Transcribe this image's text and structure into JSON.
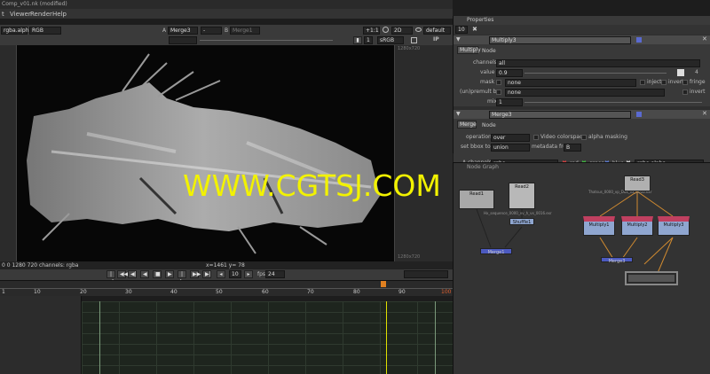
{
  "window": {
    "title": "Comp_v01.nk  (modified)"
  },
  "menubar": {
    "items": [
      "t",
      "Viewer",
      "Render",
      "Help"
    ]
  },
  "viewer": {
    "channel": "rgba.alpha",
    "colorspace": "RGB",
    "a_label": "A",
    "input_a": "Merge3",
    "a_op": "-",
    "b_label": "B",
    "input_b": "Merge1",
    "zoom": "+1:1",
    "view_mode": "2D",
    "lut": "default",
    "frame": "1",
    "display_lut": "sRGB",
    "format_top": "1280x720",
    "format_bottom": "1280x720",
    "info_left": "0 0 1280 720 channels: rgba",
    "info_coords": "x=1461 y=  78"
  },
  "watermark": "WWW.CGTSJ.COM",
  "timeline": {
    "current_frame": "10",
    "fps_label": "fps",
    "fps": "24",
    "ruler": [
      "1",
      "10",
      "20",
      "30",
      "40",
      "50",
      "60",
      "70",
      "80",
      "90",
      "100"
    ]
  },
  "properties": {
    "title": "Properties",
    "max_panels": "10",
    "multiply": {
      "node_name": "Multiply3",
      "tabs": [
        "Multiply",
        "Node"
      ],
      "channels_label": "channels",
      "channels": "all",
      "value_label": "value",
      "value": "0.9",
      "value_extra": "4",
      "mask_label": "mask",
      "mask": "none",
      "inject": "inject",
      "invert": "invert",
      "fringe": "fringe",
      "premult_label": "(un)premult by",
      "premult": "none",
      "invert2": "invert",
      "mix_label": "mix",
      "mix": "1"
    },
    "merge": {
      "node_name": "Merge3",
      "tabs": [
        "Merge",
        "Node"
      ],
      "operation_label": "operation",
      "operation": "over",
      "video_colorspace": "Video colorspace",
      "alpha_masking": "alpha masking",
      "bbox_label": "set bbox to",
      "bbox": "union",
      "metadata_label": "metadata from",
      "metadata": "B",
      "a_channels_label": "A channels",
      "a_channels": "rgba",
      "red": "red",
      "green": "green",
      "blue": "blue",
      "alpha_channel": "rgba.alpha"
    }
  },
  "node_graph": {
    "title": "Node Graph",
    "nodes": {
      "read1": "Read1",
      "read2": "Read2",
      "read3": "Read3",
      "shuffle": "Shuffle1",
      "merge1": "Merge1",
      "multiply1": "Multiply1",
      "multiply2": "Multiply2",
      "multiply3": "Multiply3",
      "merge3": "Merge3"
    },
    "read2_path": "Hx_sequence_0000_vv_h_vx_0016.exr",
    "read3_path": "Thatsus_0000_vp_Dux_vx_0016.exr"
  },
  "colors": {
    "accent": "#e0e000",
    "node_read": "#b0b0b0",
    "node_merge": "#4c5ac0",
    "node_multiply": "#8fa6d0",
    "node_red": "#c04060",
    "watermark": "#f2f200"
  }
}
